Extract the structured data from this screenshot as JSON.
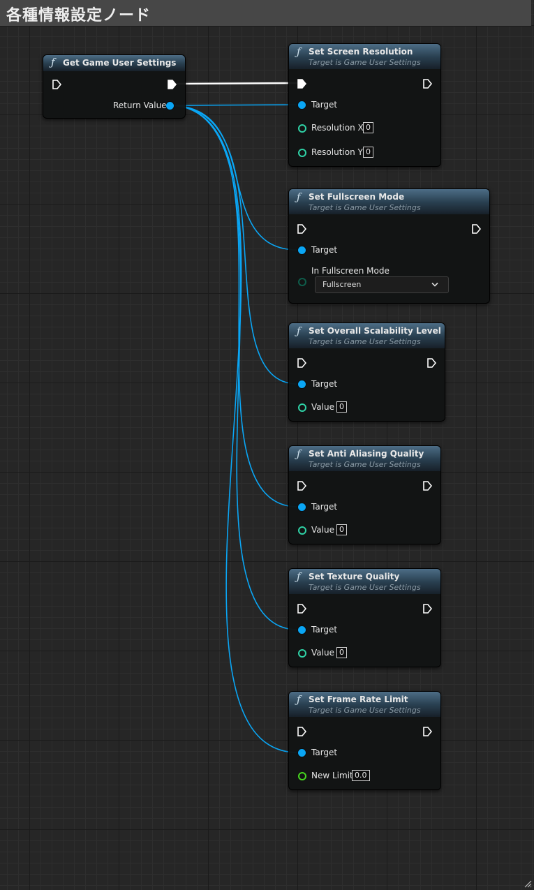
{
  "page_title": "各種情報設定ノード",
  "colors": {
    "exec_wire": "#ffffff",
    "object_wire": "#0aa6f5",
    "numeric_pin": "#2fd2a6",
    "float_pin": "#46d61f"
  },
  "nodes": {
    "get_settings": {
      "title": "Get Game User Settings",
      "return_label": "Return Value"
    },
    "set_resolution": {
      "title": "Set Screen Resolution",
      "subtitle": "Target is Game User Settings",
      "target_label": "Target",
      "resx_label": "Resolution X",
      "resx_value": "0",
      "resy_label": "Resolution Y",
      "resy_value": "0"
    },
    "set_fullscreen": {
      "title": "Set Fullscreen Mode",
      "subtitle": "Target is Game User Settings",
      "target_label": "Target",
      "mode_label": "In Fullscreen Mode",
      "mode_value": "Fullscreen"
    },
    "set_scalability": {
      "title": "Set Overall Scalability Level",
      "subtitle": "Target is Game User Settings",
      "target_label": "Target",
      "value_label": "Value",
      "value": "0"
    },
    "set_aa": {
      "title": "Set Anti Aliasing Quality",
      "subtitle": "Target is Game User Settings",
      "target_label": "Target",
      "value_label": "Value",
      "value": "0"
    },
    "set_texture": {
      "title": "Set Texture Quality",
      "subtitle": "Target is Game User Settings",
      "target_label": "Target",
      "value_label": "Value",
      "value": "0"
    },
    "set_framerate": {
      "title": "Set Frame Rate Limit",
      "subtitle": "Target is Game User Settings",
      "target_label": "Target",
      "limit_label": "New Limit",
      "limit_value": "0.0"
    }
  }
}
